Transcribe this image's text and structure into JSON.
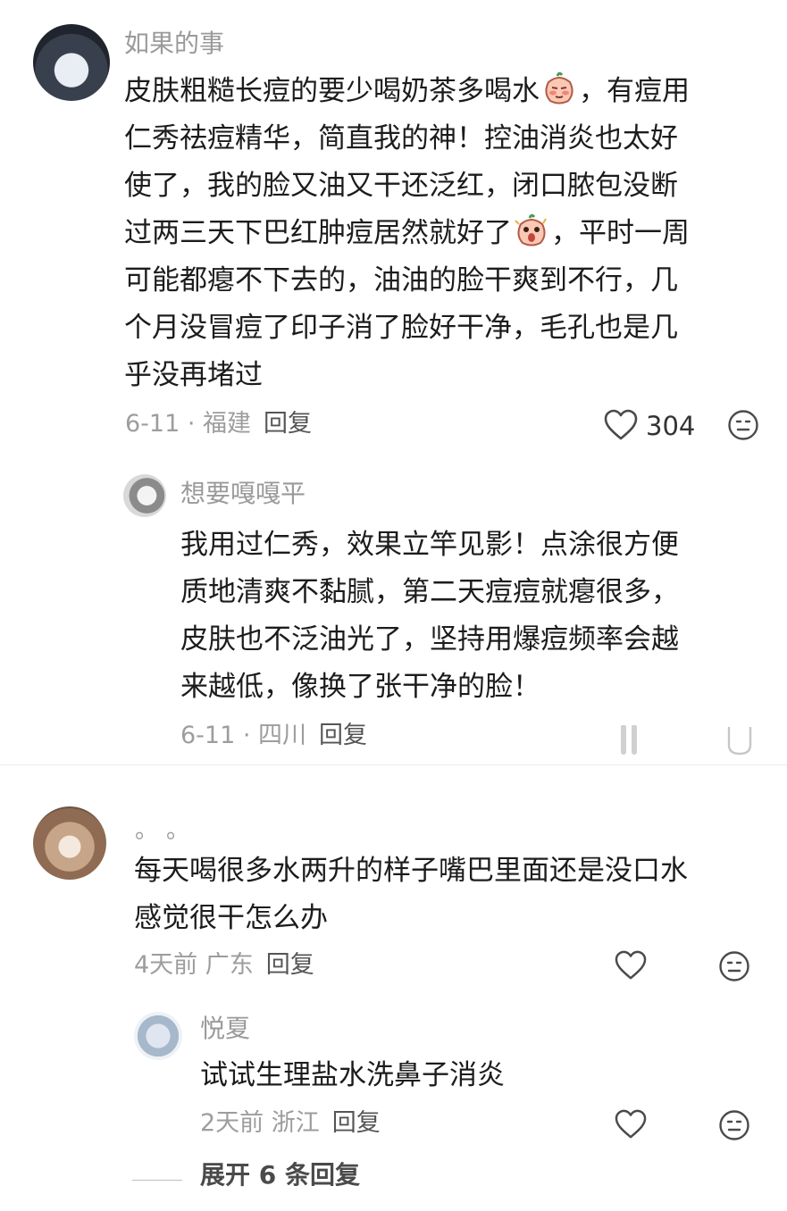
{
  "comments": [
    {
      "username": "如果的事",
      "lines": [
        "皮肤粗糙长痘的要少喝奶茶多喝水",
        "，有痘用",
        "仁秀祛痘精华，简直我的神！控油消炎也太好",
        "使了，我的脸又油又干还泛红，闭口脓包没断",
        "过两三天下巴红肿痘居然就好了",
        "，平时一周",
        "可能都瘪不下去的，油油的脸干爽到不行，几",
        "个月没冒痘了印子消了脸好干净，毛孔也是几",
        "乎没再堵过"
      ],
      "meta": "6-11 · 福建",
      "reply_label": "回复",
      "likes": "304",
      "reply": {
        "username": "想要嘎嘎平",
        "lines": [
          "我用过仁秀，效果立竿见影！点涂很方便",
          "质地清爽不黏腻，第二天痘痘就瘪很多，",
          "皮肤也不泛油光了，坚持用爆痘频率会越",
          "来越低，像换了张干净的脸！"
        ],
        "meta": "6-11 · 四川",
        "reply_label": "回复"
      }
    },
    {
      "username": "。。",
      "lines": [
        "每天喝很多水两升的样子嘴巴里面还是没口水",
        "感觉很干怎么办"
      ],
      "meta": "4天前 广东",
      "reply_label": "回复",
      "reply": {
        "username": "悦夏",
        "lines": [
          "试试生理盐水洗鼻子消炎"
        ],
        "meta": "2天前 浙江",
        "reply_label": "回复"
      }
    }
  ],
  "expand_replies": "展开 6 条回复",
  "icons": {
    "like": "heart-outline-icon",
    "dislike": "meh-face-icon",
    "emoji1": "blushing-face-emoji",
    "emoji2": "shocked-face-emoji"
  },
  "colors": {
    "text": "#1c1c1c",
    "meta": "#9d9d9d",
    "username": "#9a9a9a"
  }
}
